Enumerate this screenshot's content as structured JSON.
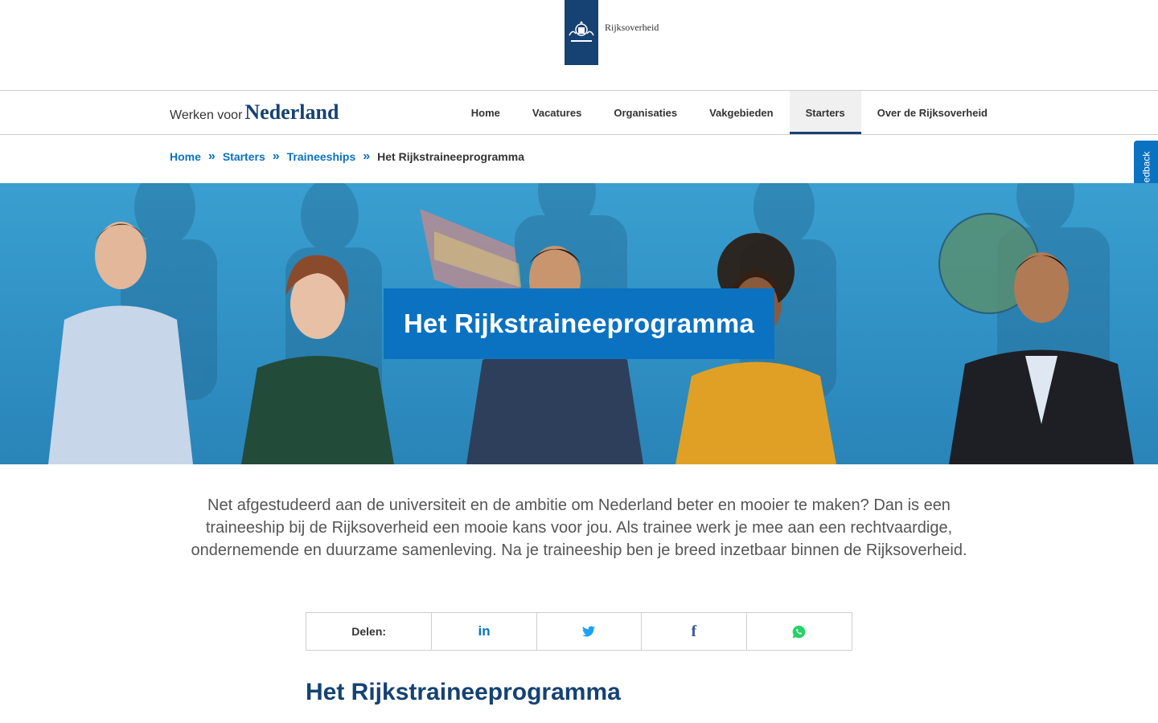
{
  "header": {
    "logo_text": "Rijksoverheid"
  },
  "nav": {
    "brand_small": "Werken voor",
    "brand_big": "Nederland",
    "items": [
      {
        "label": "Home"
      },
      {
        "label": "Vacatures"
      },
      {
        "label": "Organisaties"
      },
      {
        "label": "Vakgebieden"
      },
      {
        "label": "Starters",
        "active": true
      },
      {
        "label": "Over de Rijksoverheid"
      }
    ]
  },
  "breadcrumb": {
    "items": [
      "Home",
      "Starters",
      "Traineeships"
    ],
    "separator": "»",
    "current": "Het Rijkstraineeprogramma"
  },
  "feedback": {
    "label": "Feedback"
  },
  "hero": {
    "title": "Het Rijkstraineeprogramma"
  },
  "intro": {
    "text": "Net afgestudeerd aan de universiteit en de ambitie om Nederland beter en mooier te maken? Dan is een traineeship bij de Rijksoverheid een mooie kans voor jou. Als trainee werk je mee aan een rechtvaardige, ondernemende en duurzame samenleving. Na je traineeship ben je breed inzetbaar binnen de Rijksoverheid."
  },
  "share": {
    "label": "Delen:",
    "buttons": [
      {
        "icon": "linkedin-icon",
        "glyph": "in",
        "color": "#0b72c1"
      },
      {
        "icon": "twitter-icon",
        "color": "#1da1f2"
      },
      {
        "icon": "facebook-icon",
        "glyph": "f",
        "color": "#3b5998"
      },
      {
        "icon": "whatsapp-icon",
        "color": "#25d366"
      }
    ]
  },
  "content": {
    "section_title": "Het Rijkstraineeprogramma"
  }
}
